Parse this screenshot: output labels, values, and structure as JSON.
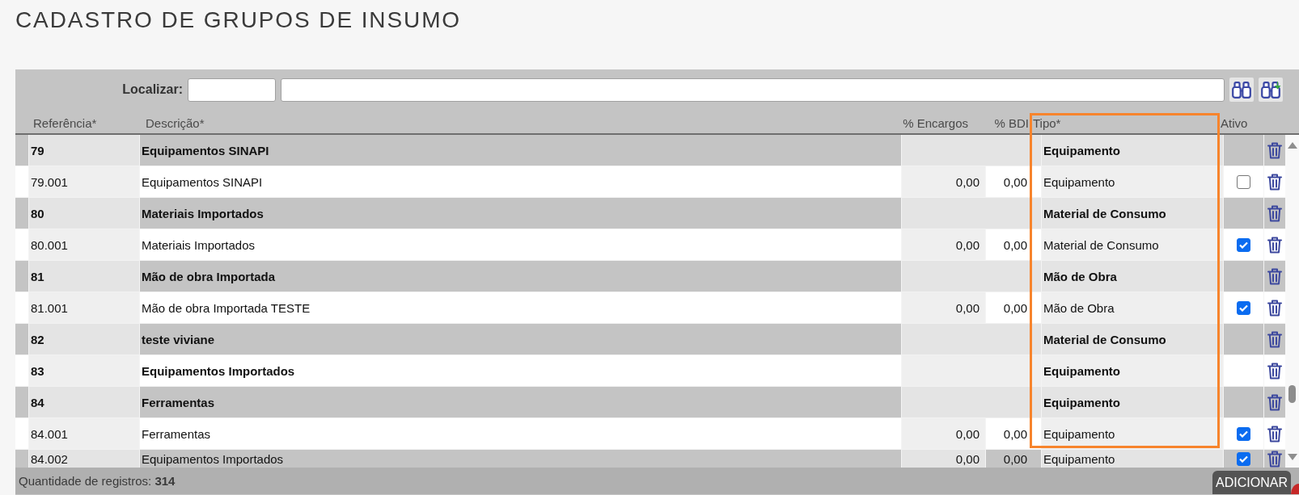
{
  "page": {
    "title": "CADASTRO DE GRUPOS DE INSUMO"
  },
  "search": {
    "label": "Localizar:",
    "buttons": [
      {
        "kind": "search"
      },
      {
        "kind": "search_add"
      }
    ]
  },
  "table": {
    "columns": [
      {
        "label": "Referência*",
        "highlighted": false
      },
      {
        "label": "Descrição*",
        "highlighted": false
      },
      {
        "label": "% Encargos",
        "highlighted": false
      },
      {
        "label": "% BDI",
        "highlighted": false
      },
      {
        "label": "Tipo*",
        "highlighted": true
      },
      {
        "label": "Ativo",
        "highlighted": false
      }
    ],
    "rows": [
      {
        "kind": "group",
        "reference": "79",
        "description": "Equipamentos SINAPI",
        "type": "Equipamento"
      },
      {
        "kind": "item",
        "reference": "79.001",
        "description": "Equipamentos SINAPI",
        "charges": "0,00",
        "bdi": "0,00",
        "type": "Equipamento",
        "active": false
      },
      {
        "kind": "group",
        "reference": "80",
        "description": "Materiais Importados",
        "type": "Material de Consumo"
      },
      {
        "kind": "item",
        "reference": "80.001",
        "description": "Materiais Importados",
        "charges": "0,00",
        "bdi": "0,00",
        "type": "Material de Consumo",
        "active": true
      },
      {
        "kind": "group",
        "reference": "81",
        "description": "Mão de obra Importada",
        "type": "Mão de Obra"
      },
      {
        "kind": "item",
        "reference": "81.001",
        "description": "Mão de obra Importada TESTE",
        "charges": "0,00",
        "bdi": "0,00",
        "type": "Mão de Obra",
        "active": true
      },
      {
        "kind": "group",
        "reference": "82",
        "description": "teste viviane",
        "type": "Material de Consumo"
      },
      {
        "kind": "group",
        "reference": "83",
        "description": "Equipamentos Importados",
        "type": "Equipamento"
      },
      {
        "kind": "group",
        "reference": "84",
        "description": "Ferramentas",
        "type": "Equipamento"
      },
      {
        "kind": "item",
        "reference": "84.001",
        "description": "Ferramentas",
        "charges": "0,00",
        "bdi": "0,00",
        "type": "Equipamento",
        "active": true
      },
      {
        "kind": "item",
        "reference": "84.002",
        "description": "Equipamentos Importados",
        "charges": "0,00",
        "bdi": "0,00",
        "type": "Equipamento",
        "active": true
      }
    ]
  },
  "footer": {
    "record_count": "Quantidade de registros: **314**",
    "add_button": "ADICIONAR"
  }
}
